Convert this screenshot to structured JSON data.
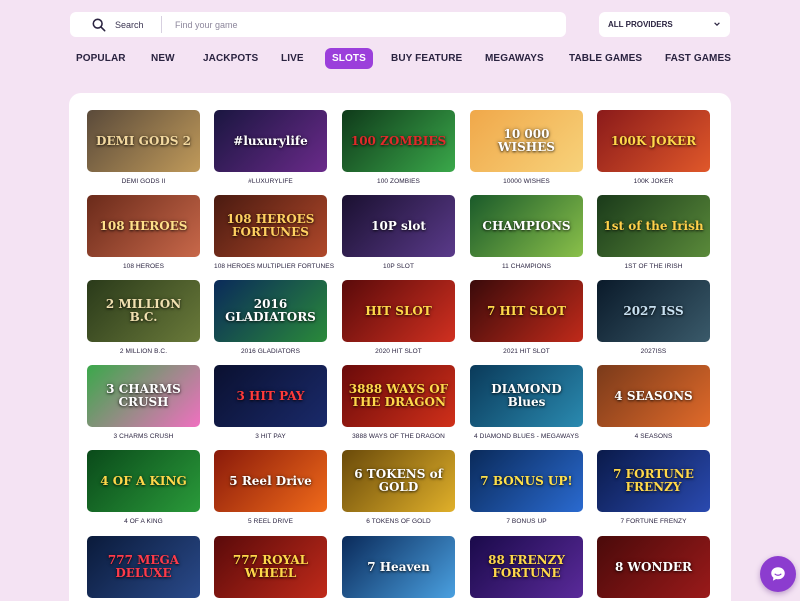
{
  "search": {
    "label": "Search",
    "placeholder": "Find your game"
  },
  "provider_select": {
    "value": "ALL PROVIDERS",
    "icon": "chevron-down-icon"
  },
  "tabs": [
    {
      "label": "POPULAR",
      "active": false
    },
    {
      "label": "NEW",
      "active": false
    },
    {
      "label": "JACKPOTS",
      "active": false
    },
    {
      "label": "LIVE",
      "active": false
    },
    {
      "label": "SLOTS",
      "active": true
    },
    {
      "label": "BUY FEATURE",
      "active": false
    },
    {
      "label": "MEGAWAYS",
      "active": false
    },
    {
      "label": "TABLE GAMES",
      "active": false
    },
    {
      "label": "FAST GAMES",
      "active": false
    }
  ],
  "games": [
    {
      "name": "DEMI GODS II",
      "logo": "DEMI GODS 2",
      "colors": [
        "#5a4a3a",
        "#c09a5a"
      ],
      "logo_color": "#f3d9a0"
    },
    {
      "name": "#LUXURYLIFE",
      "logo": "#luxurylife",
      "colors": [
        "#1a1640",
        "#6a2a8a"
      ],
      "logo_color": "#ffffff"
    },
    {
      "name": "100 ZOMBIES",
      "logo": "100 ZOMBIES",
      "colors": [
        "#0f3a1a",
        "#3aa84a"
      ],
      "logo_color": "#e02a2a"
    },
    {
      "name": "10000 WISHES",
      "logo": "10 000 WISHES",
      "colors": [
        "#f0a84a",
        "#f7d27a"
      ],
      "logo_color": "#ffffff"
    },
    {
      "name": "100K JOKER",
      "logo": "100K JOKER",
      "colors": [
        "#8a1a1a",
        "#e0582a"
      ],
      "logo_color": "#ffd84a"
    },
    {
      "name": "108 HEROES",
      "logo": "108 HEROES",
      "colors": [
        "#6a2a1a",
        "#c8684a"
      ],
      "logo_color": "#ffe08a"
    },
    {
      "name": "108 HEROES MULTIPLIER FORTUNES",
      "logo": "108 HEROES FORTUNES",
      "colors": [
        "#4a1a10",
        "#b0482a"
      ],
      "logo_color": "#ffd060"
    },
    {
      "name": "10P SLOT",
      "logo": "10P slot",
      "colors": [
        "#1a1030",
        "#5a3a8a"
      ],
      "logo_color": "#ffffff"
    },
    {
      "name": "11 CHAMPIONS",
      "logo": "CHAMPIONS",
      "colors": [
        "#1a5a2a",
        "#8ac04a"
      ],
      "logo_color": "#ffffff"
    },
    {
      "name": "1ST OF THE IRISH",
      "logo": "1st of the Irish",
      "colors": [
        "#1a3a1a",
        "#5a8a3a"
      ],
      "logo_color": "#ffd04a"
    },
    {
      "name": "2 MILLION B.C.",
      "logo": "2 MILLION B.C.",
      "colors": [
        "#2a3a1a",
        "#6a7a3a"
      ],
      "logo_color": "#f0e0b0"
    },
    {
      "name": "2016 GLADIATORS",
      "logo": "2016 GLADIATORS",
      "colors": [
        "#0a2a5a",
        "#2a8a3a"
      ],
      "logo_color": "#ffffff"
    },
    {
      "name": "2020 HIT SLOT",
      "logo": "HIT SLOT",
      "colors": [
        "#5a0a0a",
        "#d03020"
      ],
      "logo_color": "#ffd84a"
    },
    {
      "name": "2021 HIT SLOT",
      "logo": "7 HIT SLOT",
      "colors": [
        "#3a0a0a",
        "#c02a1a"
      ],
      "logo_color": "#ffd84a"
    },
    {
      "name": "2027ISS",
      "logo": "2027 ISS",
      "colors": [
        "#0a1a2a",
        "#3a5a6a"
      ],
      "logo_color": "#c8e0f0"
    },
    {
      "name": "3 CHARMS CRUSH",
      "logo": "3 CHARMS CRUSH",
      "colors": [
        "#3aa84a",
        "#f070c0"
      ],
      "logo_color": "#ffffff"
    },
    {
      "name": "3 HIT PAY",
      "logo": "3 HIT PAY",
      "colors": [
        "#0a1030",
        "#1a2a6a"
      ],
      "logo_color": "#ff3a3a"
    },
    {
      "name": "3888 WAYS OF THE DRAGON",
      "logo": "3888 WAYS OF THE DRAGON",
      "colors": [
        "#6a0a0a",
        "#d0301a"
      ],
      "logo_color": "#ffd84a"
    },
    {
      "name": "4 DIAMOND BLUES - MEGAWAYS",
      "logo": "DIAMOND Blues",
      "colors": [
        "#0a3a5a",
        "#2a8ab0"
      ],
      "logo_color": "#ffffff"
    },
    {
      "name": "4 SEASONS",
      "logo": "4 SEASONS",
      "colors": [
        "#7a3a1a",
        "#e06a2a"
      ],
      "logo_color": "#ffffff"
    },
    {
      "name": "4 OF A KING",
      "logo": "4 OF A KING",
      "colors": [
        "#0a4a1a",
        "#2a9a3a"
      ],
      "logo_color": "#ffd84a"
    },
    {
      "name": "5 REEL DRIVE",
      "logo": "5 Reel Drive",
      "colors": [
        "#8a1a0a",
        "#f06a1a"
      ],
      "logo_color": "#ffffff"
    },
    {
      "name": "6 TOKENS OF GOLD",
      "logo": "6 TOKENS of GOLD",
      "colors": [
        "#6a4a0a",
        "#e0b02a"
      ],
      "logo_color": "#ffffff"
    },
    {
      "name": "7 BONUS UP",
      "logo": "7 BONUS UP!",
      "colors": [
        "#0a2a5a",
        "#2a6ad0"
      ],
      "logo_color": "#ffe04a"
    },
    {
      "name": "7 FORTUNE FRENZY",
      "logo": "7 FORTUNE FRENZY",
      "colors": [
        "#0a1a4a",
        "#2a4ab0"
      ],
      "logo_color": "#ffd84a"
    },
    {
      "name": "",
      "logo": "777 MEGA DELUXE",
      "colors": [
        "#0a1a3a",
        "#2a4a8a"
      ],
      "logo_color": "#ff3a4a"
    },
    {
      "name": "",
      "logo": "777 ROYAL WHEEL",
      "colors": [
        "#5a0a0a",
        "#c02a1a"
      ],
      "logo_color": "#ffd84a"
    },
    {
      "name": "",
      "logo": "7 Heaven",
      "colors": [
        "#0a2a5a",
        "#4aa0e0"
      ],
      "logo_color": "#ffffff"
    },
    {
      "name": "",
      "logo": "88 FRENZY FORTUNE",
      "colors": [
        "#1a0a4a",
        "#5a2a9a"
      ],
      "logo_color": "#ffd84a"
    },
    {
      "name": "",
      "logo": "8 WONDER",
      "colors": [
        "#4a0a0a",
        "#9a1a1a"
      ],
      "logo_color": "#ffffff"
    }
  ],
  "chat": {
    "icon": "chat-icon"
  }
}
